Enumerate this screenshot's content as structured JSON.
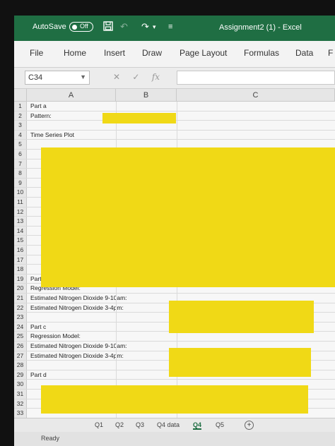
{
  "titlebar": {
    "autosave_label": "AutoSave",
    "autosave_state": "Off",
    "doc_title": "Assignment2 (1)  -  Excel",
    "save_icon": "save-icon",
    "undo_icon": "undo-icon",
    "redo_icon": "redo-icon",
    "customize_icon": "customize-icon"
  },
  "ribbon": {
    "tabs": [
      "File",
      "Home",
      "Insert",
      "Draw",
      "Page Layout",
      "Formulas",
      "Data",
      "F"
    ]
  },
  "formula_bar": {
    "name_box": "C34",
    "fx": "fx",
    "cancel": "✕",
    "confirm": "✓",
    "value": ""
  },
  "columns": [
    "A",
    "B",
    "C"
  ],
  "rows": [
    {
      "n": "1",
      "text": "Part a"
    },
    {
      "n": "2",
      "text": "Pattern:"
    },
    {
      "n": "3",
      "text": ""
    },
    {
      "n": "4",
      "text": "Time Series Plot"
    },
    {
      "n": "5",
      "text": ""
    },
    {
      "n": "6",
      "text": ""
    },
    {
      "n": "7",
      "text": ""
    },
    {
      "n": "8",
      "text": ""
    },
    {
      "n": "9",
      "text": ""
    },
    {
      "n": "10",
      "text": ""
    },
    {
      "n": "11",
      "text": ""
    },
    {
      "n": "12",
      "text": ""
    },
    {
      "n": "13",
      "text": ""
    },
    {
      "n": "14",
      "text": ""
    },
    {
      "n": "15",
      "text": ""
    },
    {
      "n": "16",
      "text": ""
    },
    {
      "n": "17",
      "text": ""
    },
    {
      "n": "18",
      "text": ""
    },
    {
      "n": "19",
      "text": "Part b"
    },
    {
      "n": "20",
      "text": "Regression Model:"
    },
    {
      "n": "21",
      "text": "Estimated Nitrogen Dioxide 9-10am:"
    },
    {
      "n": "22",
      "text": "Estimated Nitrogen Dioxide 3-4pm:"
    },
    {
      "n": "23",
      "text": ""
    },
    {
      "n": "24",
      "text": "Part c"
    },
    {
      "n": "25",
      "text": "Regression Model:"
    },
    {
      "n": "26",
      "text": "Estimated Nitrogen Dioxide 9-10am:"
    },
    {
      "n": "27",
      "text": "Estimated Nitrogen Dioxide 3-4pm:"
    },
    {
      "n": "28",
      "text": ""
    },
    {
      "n": "29",
      "text": "Part d"
    },
    {
      "n": "30",
      "text": ""
    },
    {
      "n": "31",
      "text": ""
    },
    {
      "n": "32",
      "text": ""
    },
    {
      "n": "33",
      "text": ""
    }
  ],
  "sheets": [
    "Q1",
    "Q2",
    "Q3",
    "Q4 data",
    "Q4",
    "Q5"
  ],
  "active_sheet": "Q4",
  "status": "Ready",
  "colors": {
    "highlight": "#f0d916",
    "excel_green": "#1f6e43"
  }
}
